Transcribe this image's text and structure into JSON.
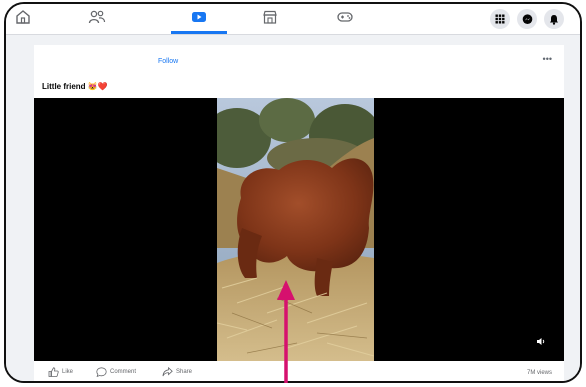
{
  "nav": {
    "tabs": [
      {
        "icon": "home-icon",
        "active": false
      },
      {
        "icon": "friends-icon",
        "active": false
      },
      {
        "icon": "watch-icon",
        "active": true
      },
      {
        "icon": "marketplace-icon",
        "active": false
      },
      {
        "icon": "gaming-icon",
        "active": false
      }
    ],
    "right_buttons": [
      "menu-grid-icon",
      "messenger-icon",
      "notifications-icon"
    ],
    "accent_color": "#1877f2"
  },
  "post": {
    "follow_label": "Follow",
    "more_label": "•••",
    "caption": "Little friend 😻❤️",
    "video": {
      "subject": "highland calf in hay",
      "volume_icon": "volume-icon"
    },
    "actions": {
      "like_label": "Like",
      "comment_label": "Comment",
      "share_label": "Share"
    },
    "views": "7M views"
  },
  "annotation": {
    "type": "arrow",
    "color": "#d6116e"
  }
}
